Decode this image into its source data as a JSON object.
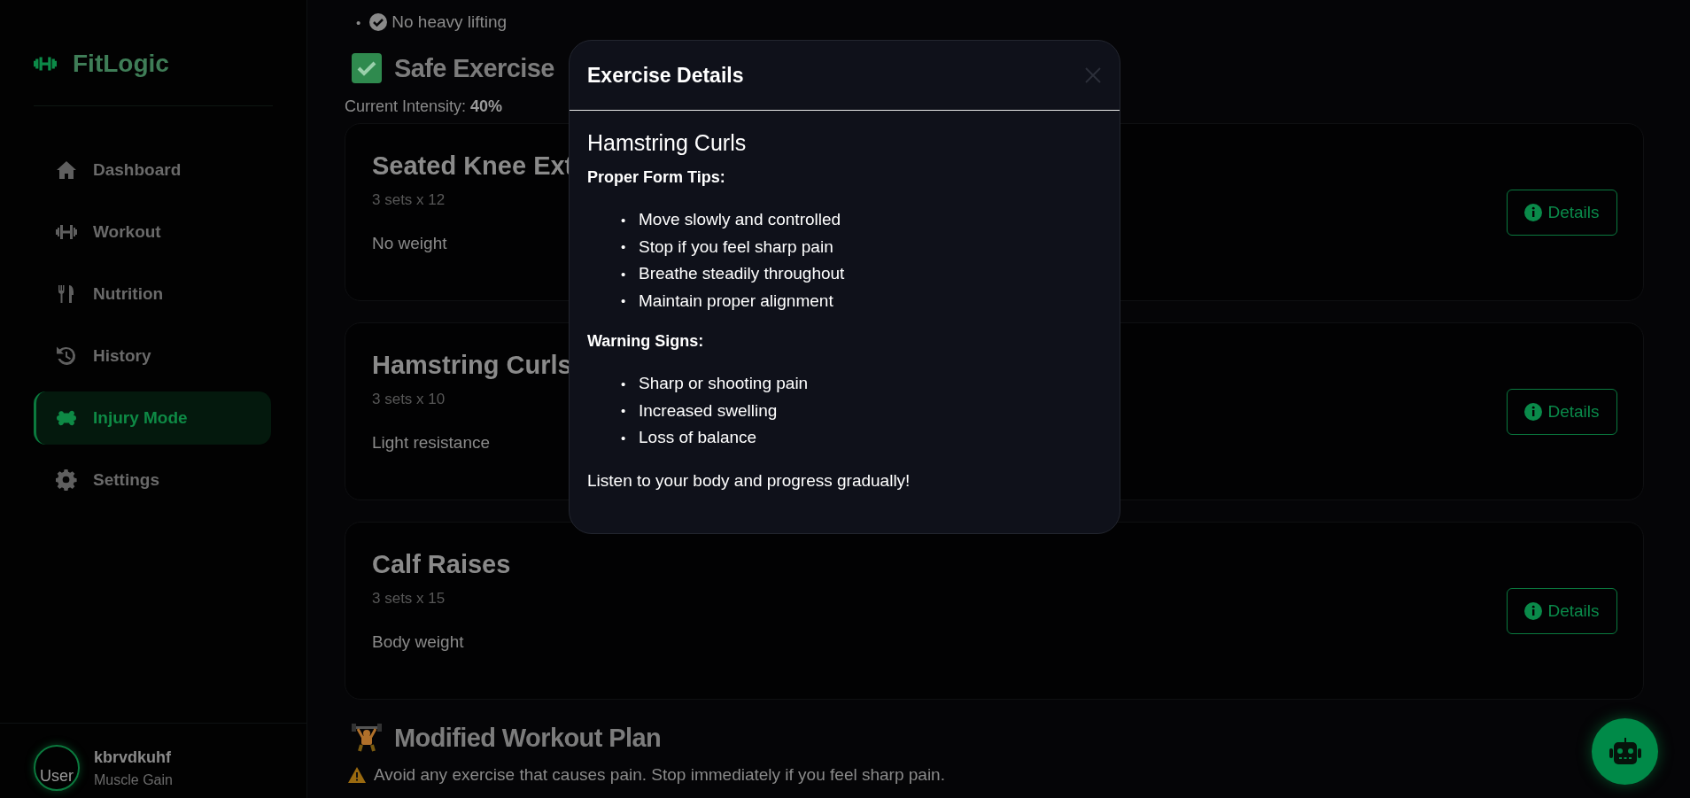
{
  "sidebar": {
    "brand": "FitLogic",
    "items": [
      {
        "label": "Dashboard",
        "selected": false
      },
      {
        "label": "Workout",
        "selected": false
      },
      {
        "label": "Nutrition",
        "selected": false
      },
      {
        "label": "History",
        "selected": false
      },
      {
        "label": "Injury Mode",
        "selected": true
      },
      {
        "label": "Settings",
        "selected": false
      }
    ],
    "user": {
      "avatar": "User",
      "name": "kbrvdkuhf",
      "goal": "Muscle Gain"
    }
  },
  "main": {
    "restrictions": [
      {
        "bullet": "•",
        "text": "No heavy lifting"
      }
    ],
    "safe_heading": "Safe Exercise",
    "intensity": "Current Intensity: **40%**",
    "exercises": [
      {
        "name": "Seated Knee Ext",
        "sets": "3 sets x 12",
        "note": "No weight",
        "button": "Details"
      },
      {
        "name": "Hamstring Curls",
        "sets": "3 sets x 10",
        "note": "Light resistance",
        "button": "Details"
      },
      {
        "name": "Calf Raises",
        "sets": "3 sets x 15",
        "note": "Body weight",
        "button": "Details"
      }
    ],
    "plan_heading": "Modified Workout Plan",
    "warning": "Avoid any exercise that causes pain. Stop immediately if you feel sharp pain."
  },
  "modal": {
    "title": "Exercise Details",
    "exercise": "Hamstring Curls",
    "sections": [
      {
        "heading": "Proper Form Tips:",
        "items": [
          {
            "bullet": "•",
            "text": "Move slowly and controlled"
          },
          {
            "bullet": "•",
            "text": "Stop if you feel sharp pain"
          },
          {
            "bullet": "•",
            "text": "Breathe steadily throughout"
          },
          {
            "bullet": "•",
            "text": "Maintain proper alignment"
          }
        ]
      },
      {
        "heading": "Warning Signs:",
        "items": [
          {
            "bullet": "•",
            "text": "Sharp or shooting pain"
          },
          {
            "bullet": "•",
            "text": "Increased swelling"
          },
          {
            "bullet": "•",
            "text": "Loss of balance"
          }
        ]
      }
    ],
    "footer": "Listen to your body and progress gradually!"
  }
}
